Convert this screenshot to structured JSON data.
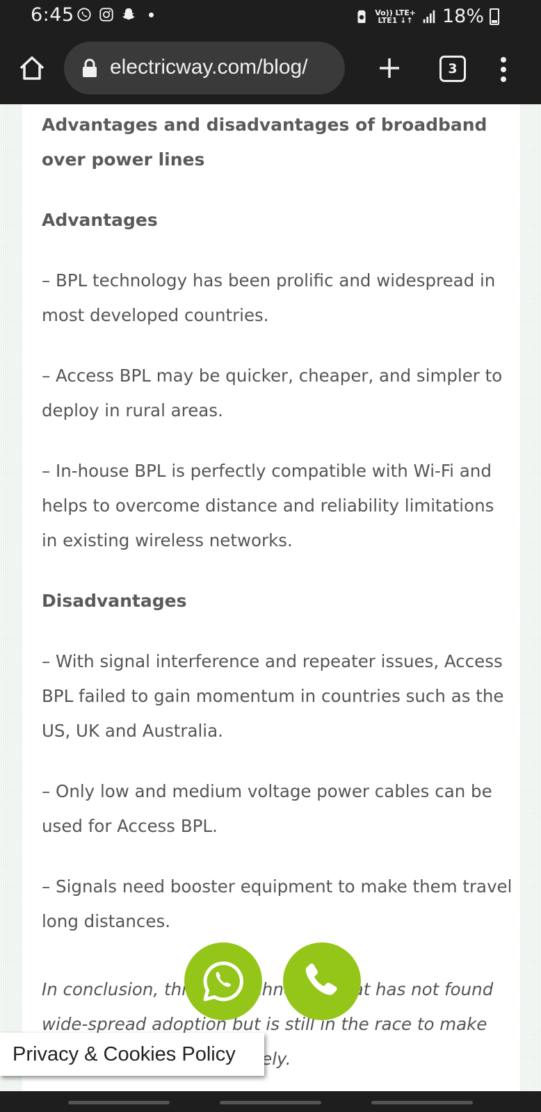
{
  "status_bar": {
    "time": "6:45",
    "left_icons": [
      "whatsapp-icon",
      "instagram-icon",
      "snapchat-icon",
      "dot-icon"
    ],
    "network_top": "Vo)) LTE+",
    "network_bottom": "LTE1 ↓↑",
    "battery_percent": "18%"
  },
  "toolbar": {
    "url": "electricway.com/blog/",
    "tab_count": "3"
  },
  "article": {
    "heading": "Advantages and disadvantages of broadband over power lines",
    "advantages_title": "Advantages",
    "advantages": [
      "– BPL technology has been prolific and widespread in most developed countries.",
      "– Access BPL may be quicker, cheaper, and simpler to deploy in rural areas.",
      "– In-house BPL is perfectly compatible with Wi-Fi and helps to overcome distance and reliability limitations in existing wireless networks."
    ],
    "disadvantages_title": "Disadvantages",
    "disadvantages": [
      "– With signal interference and repeater issues, Access BPL failed to gain momentum in countries such as the US, UK and Australia.",
      "– Only low and medium voltage power cables can be used for Access BPL.",
      "– Signals need booster equipment to make them travel long distances."
    ],
    "conclusion": "In conclusion, this is a technology that has not found wide-spread adoption but is still in the race to make things more available widely."
  },
  "privacy_label": "Privacy & Cookies Policy",
  "colors": {
    "fab_green": "#94c61a",
    "text_gray": "#555555",
    "chrome_dark": "#1e1e1e"
  }
}
